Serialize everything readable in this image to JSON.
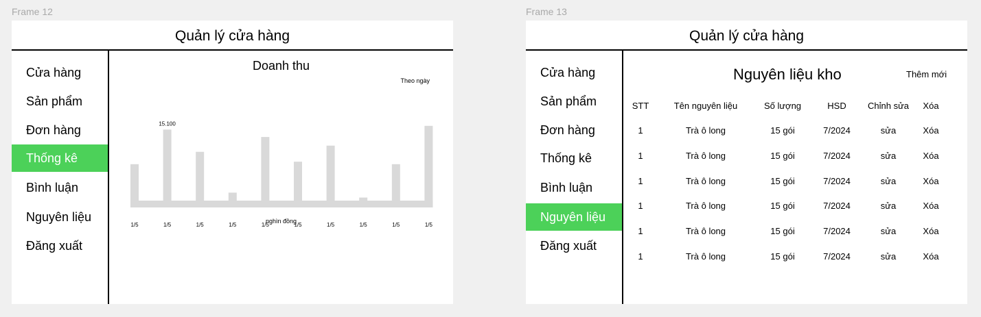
{
  "frames": [
    {
      "label": "Frame 12",
      "title": "Quản lý cửa hàng",
      "sidebar": [
        "Cửa hàng",
        "Sản phẩm",
        "Đơn hàng",
        "Thống kê",
        "Bình luận",
        "Nguyên liệu",
        "Đăng xuất"
      ],
      "active_item": "Thống kê",
      "revenue": {
        "title": "Doanh thu",
        "filter": "Theo ngày",
        "unit": "nghìn đồng",
        "chart_data": {
          "type": "bar",
          "categories": [
            "1/5",
            "1/5",
            "1/5",
            "1/5",
            "1/5",
            "1/5",
            "1/5",
            "1/5",
            "1/5",
            "1/5"
          ],
          "values": [
            12300,
            15100,
            13300,
            10000,
            14500,
            12500,
            13800,
            9600,
            12300,
            15400
          ],
          "data_labels": [
            "",
            "15.100",
            "",
            "",
            "",
            "",
            "",
            "",
            "",
            ""
          ],
          "ylim": [
            8800,
            16000
          ],
          "bar_color": "#d9d9d9"
        }
      }
    },
    {
      "label": "Frame 13",
      "title": "Quản lý cửa hàng",
      "sidebar": [
        "Cửa hàng",
        "Sản phẩm",
        "Đơn hàng",
        "Thống kê",
        "Bình luận",
        "Nguyên liệu",
        "Đăng xuất"
      ],
      "active_item": "Nguyên liệu",
      "warehouse": {
        "title": "Nguyên liệu kho",
        "add_label": "Thêm mới",
        "columns": [
          "STT",
          "Tên nguyên liệu",
          "Số lượng",
          "HSD",
          "Chỉnh sửa",
          "Xóa"
        ],
        "rows": [
          [
            "1",
            "Trà ô long",
            "15 gói",
            "7/2024",
            "sửa",
            "Xóa"
          ],
          [
            "1",
            "Trà ô long",
            "15 gói",
            "7/2024",
            "sửa",
            "Xóa"
          ],
          [
            "1",
            "Trà ô long",
            "15 gói",
            "7/2024",
            "sửa",
            "Xóa"
          ],
          [
            "1",
            "Trà ô long",
            "15 gói",
            "7/2024",
            "sửa",
            "Xóa"
          ],
          [
            "1",
            "Trà ô long",
            "15 gói",
            "7/2024",
            "sửa",
            "Xóa"
          ],
          [
            "1",
            "Trà ô long",
            "15 gói",
            "7/2024",
            "sửa",
            "Xóa"
          ]
        ]
      }
    }
  ],
  "colors": {
    "active": "#4cd159",
    "background": "#f0f0f0",
    "panel": "#ffffff"
  }
}
